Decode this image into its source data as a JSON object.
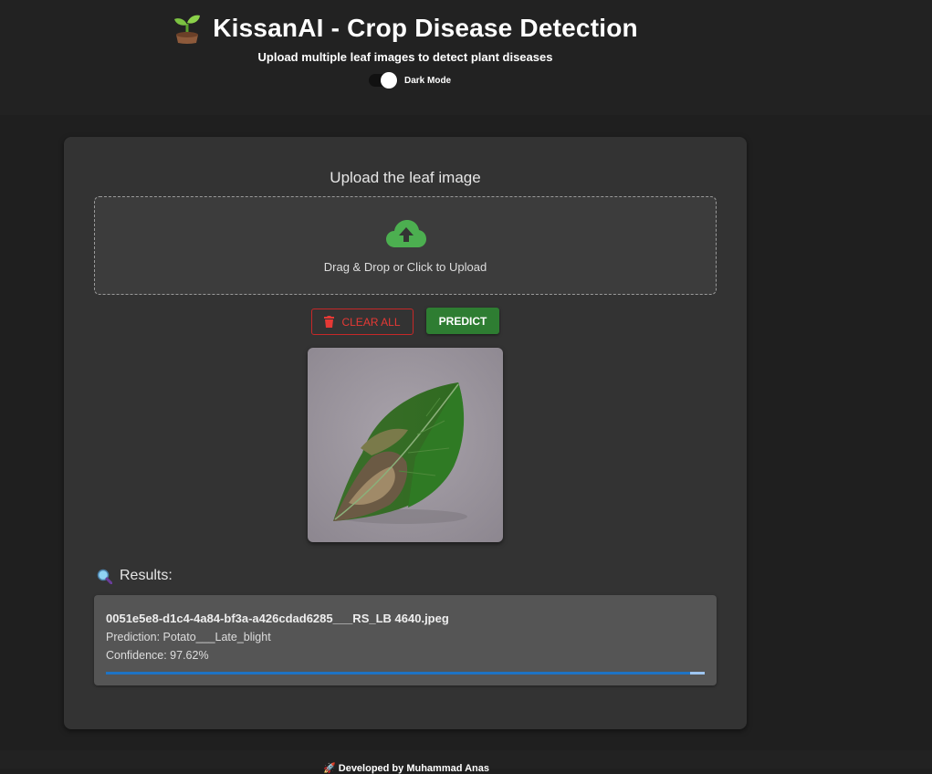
{
  "header": {
    "title": "KissanAI - Crop Disease Detection",
    "subtitle": "Upload multiple leaf images to detect plant diseases",
    "dark_mode_label": "Dark Mode",
    "dark_mode_on": true
  },
  "upload": {
    "heading": "Upload the leaf image",
    "dropzone_text": "Drag & Drop or Click to Upload"
  },
  "actions": {
    "clear_label": "CLEAR ALL",
    "predict_label": "PREDICT"
  },
  "results": {
    "heading": "Results:",
    "items": [
      {
        "filename": "0051e5e8-d1c4-4a84-bf3a-a426cdad6285___RS_LB 4640.jpeg",
        "prediction": "Prediction: Potato___Late_blight",
        "confidence": "Confidence: 97.62%",
        "confidence_value": 97.62
      }
    ]
  },
  "footer": {
    "text": "🚀 Developed by Muhammad Anas"
  },
  "colors": {
    "accent_green": "#2e7d32",
    "icon_green": "#4caf50",
    "danger_red": "#e53935",
    "progress_blue": "#1e73c4"
  },
  "icons": [
    "sprout-icon",
    "cloud-upload-icon",
    "trash-icon",
    "magnifier-icon",
    "rocket-icon"
  ]
}
